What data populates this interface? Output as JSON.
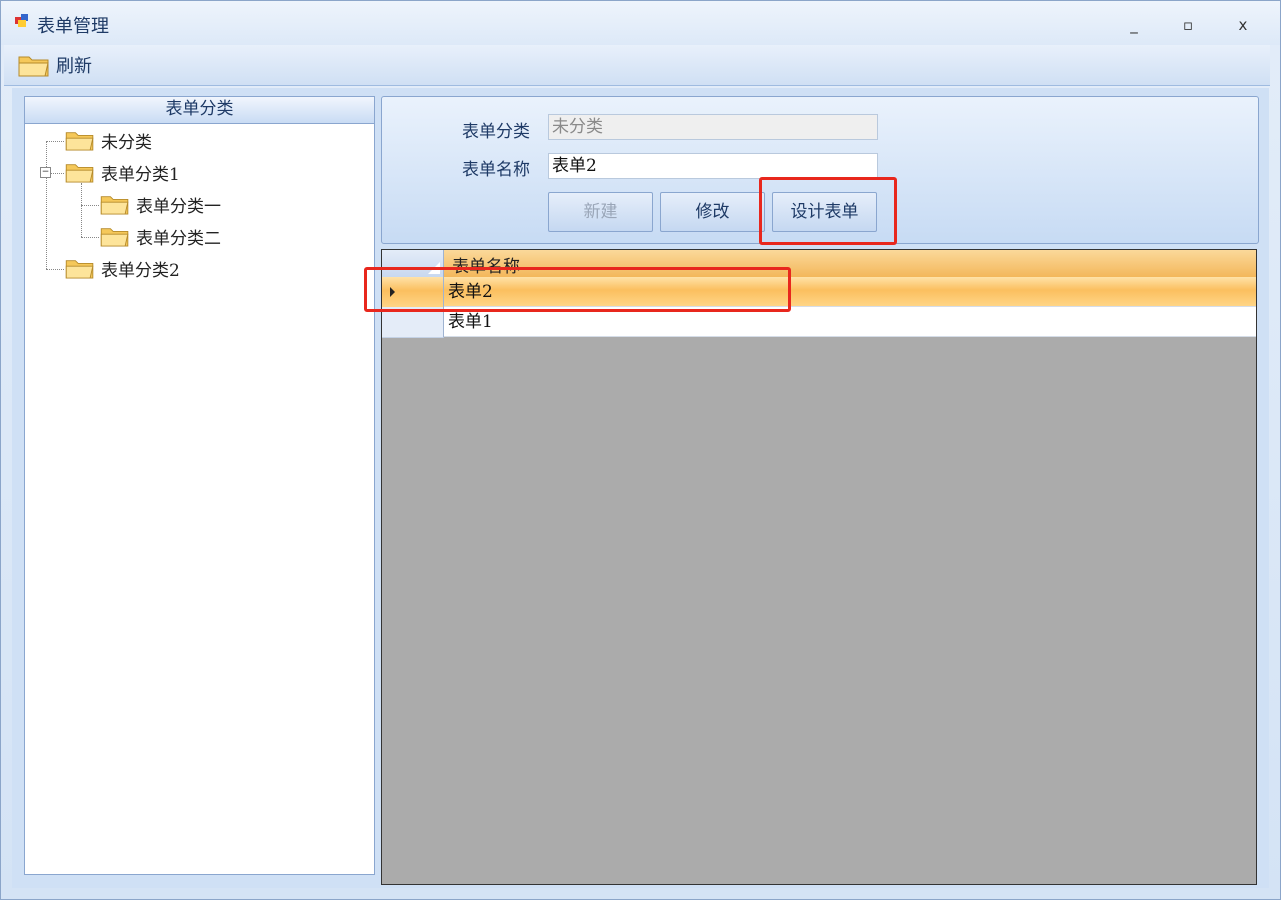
{
  "window": {
    "title": "表单管理",
    "controls": {
      "minimize": "_",
      "maximize": "▫",
      "close": "x"
    }
  },
  "toolbar": {
    "refresh_label": "刷新"
  },
  "tree": {
    "header": "表单分类",
    "nodes": [
      {
        "label": "未分类",
        "level": 0
      },
      {
        "label": "表单分类1",
        "level": 0,
        "expanded": true
      },
      {
        "label": "表单分类一",
        "level": 1
      },
      {
        "label": "表单分类二",
        "level": 1
      },
      {
        "label": "表单分类2",
        "level": 0
      }
    ]
  },
  "form": {
    "category_label": "表单分类",
    "category_value": "未分类",
    "name_label": "表单名称",
    "name_value": "表单2",
    "buttons": {
      "new": "新建",
      "edit": "修改",
      "design": "设计表单"
    }
  },
  "grid": {
    "column_header": "表单名称",
    "rows": [
      "表单2",
      "表单1"
    ],
    "selected_index": 0
  },
  "colors": {
    "highlight": "#e8271d",
    "selection": "#fbbf5f",
    "empty_area": "#ababab"
  }
}
